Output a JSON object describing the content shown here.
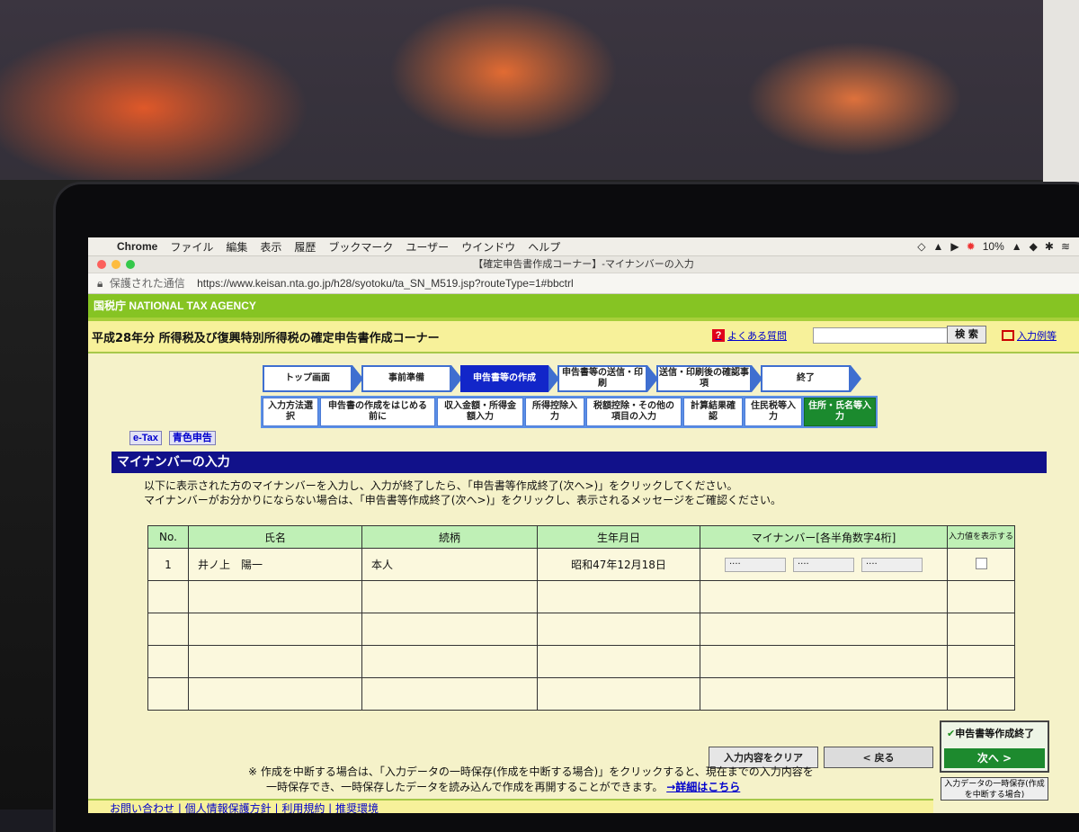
{
  "menubar": {
    "app": "Chrome",
    "items": [
      "ファイル",
      "編集",
      "表示",
      "履歴",
      "ブックマーク",
      "ユーザー",
      "ウインドウ",
      "ヘルプ"
    ],
    "battery": "10%"
  },
  "window": {
    "title": "【確定申告書作成コーナー】-マイナンバーの入力",
    "secure_label": "保護された通信",
    "url": "https://www.keisan.nta.go.jp/h28/syotoku/ta_SN_M519.jsp?routeType=1#bbctrl"
  },
  "agency": "国税庁 NATIONAL TAX AGENCY",
  "title": "平成28年分 所得税及び復興特別所得税の確定申告書作成コーナー",
  "faq_link": "よくある質問",
  "search_button": "検 索",
  "example_link": "入力例等",
  "steps": [
    {
      "label": "トップ画面",
      "w": 100,
      "cur": false
    },
    {
      "label": "事前準備",
      "w": 100,
      "cur": false
    },
    {
      "label": "申告書等の作成",
      "w": 98,
      "cur": true
    },
    {
      "label": "申告書等の送信・印刷",
      "w": 100,
      "cur": false
    },
    {
      "label": "送信・印刷後の確認事項",
      "w": 106,
      "cur": false
    },
    {
      "label": "終了",
      "w": 100,
      "cur": false
    }
  ],
  "substeps": [
    {
      "label": "入力方法選択",
      "w": 62,
      "cur": false
    },
    {
      "label": "申告書の作成をはじめる前に",
      "w": 128,
      "cur": false
    },
    {
      "label": "収入金額・所得金額入力",
      "w": 96,
      "cur": false
    },
    {
      "label": "所得控除入力",
      "w": 66,
      "cur": false
    },
    {
      "label": "税額控除・その他の項目の入力",
      "w": 106,
      "cur": false
    },
    {
      "label": "計算結果確認",
      "w": 66,
      "cur": false
    },
    {
      "label": "住民税等入力",
      "w": 64,
      "cur": false
    },
    {
      "label": "住所・氏名等入力",
      "w": 80,
      "cur": true
    }
  ],
  "tags": [
    "e-Tax",
    "青色申告"
  ],
  "heading": "マイナンバーの入力",
  "instructions": [
    "以下に表示された方のマイナンバーを入力し、入力が終了したら、「申告書等作成終了(次へ>)」をクリックしてください。",
    "マイナンバーがお分かりにならない場合は、「申告書等作成終了(次へ>)」をクリックし、表示されるメッセージをご確認ください。"
  ],
  "table": {
    "headers": [
      "No.",
      "氏名",
      "続柄",
      "生年月日",
      "マイナンバー[各半角数字4桁]",
      "入力値を表示する"
    ],
    "rows": [
      {
        "no": "1",
        "name": "井ノ上　陽一",
        "relation": "本人",
        "birth": "昭和47年12月18日",
        "mn": [
          "····",
          "····",
          "····"
        ]
      }
    ],
    "empty_rows": 4
  },
  "buttons": {
    "clear": "入力内容をクリア",
    "back": "< 戻る",
    "finish_label": "申告書等作成終了",
    "next": "次へ >",
    "save": "入力データの一時保存(作成を中断する場合)"
  },
  "note": {
    "line1": "※ 作成を中断する場合は、「入力データの一時保存(作成を中断する場合)」をクリックすると、現在までの入力内容を",
    "line2": "一時保存でき、一時保存したデータを読み込んで作成を再開することができます。",
    "link": "→詳細はこちら"
  },
  "footer": "お問い合わせ | 個人情報保護方針 | 利用規約 | 推奨環境"
}
